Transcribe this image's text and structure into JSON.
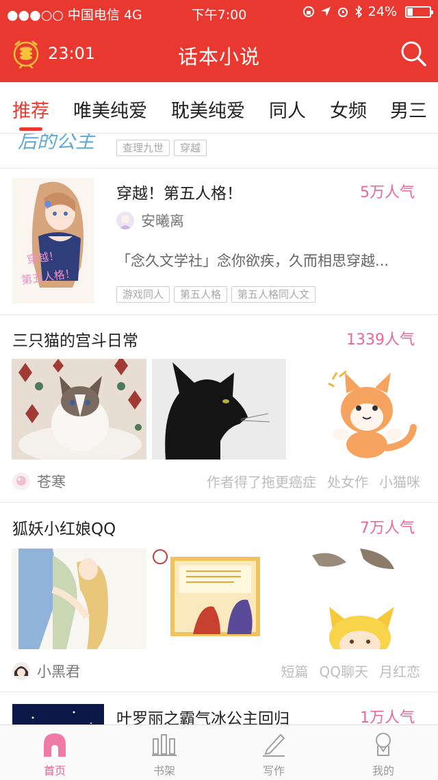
{
  "status_bar": {
    "carrier": "●●●○○ 中国电信 4G",
    "time": "下午7:00",
    "battery": "24%",
    "battery_level": 0.24
  },
  "nav": {
    "timer": "23:01",
    "title": "话本小说"
  },
  "tabs": [
    "推荐",
    "唯美纯爱",
    "耽美纯爱",
    "同人",
    "女频",
    "男三"
  ],
  "feed": {
    "partial_item": {
      "cover_text": "后的公主",
      "tags": [
        "查理九世",
        "穿越"
      ]
    },
    "book1": {
      "title": "穿越！第五人格！",
      "popularity": "5万人气",
      "author": "安曦离",
      "description": "「念久文学社」念你欲疾，久而相思穿越...",
      "tags": [
        "游戏同人",
        "第五人格",
        "第五人格同人文"
      ]
    },
    "story1": {
      "title": "三只猫的宫斗日常",
      "popularity": "1339人气",
      "author": "苍寒",
      "tags": [
        "作者得了拖更癌症",
        "处女作",
        "小猫咪"
      ]
    },
    "story2": {
      "title": "狐妖小红娘QQ",
      "popularity": "7万人气",
      "author": "小黑君",
      "tags": [
        "短篇",
        "QQ聊天",
        "月红恋"
      ]
    },
    "book2": {
      "title": "叶罗丽之霸气冰公主回归",
      "popularity": "1万人气"
    }
  },
  "tabbar": [
    {
      "label": "首页",
      "icon": "home-icon"
    },
    {
      "label": "书架",
      "icon": "bookshelf-icon"
    },
    {
      "label": "写作",
      "icon": "pen-icon"
    },
    {
      "label": "我的",
      "icon": "profile-icon"
    }
  ],
  "colors": {
    "brand_red": "#e8382f",
    "popularity_pink": "#e9679a",
    "active_tab_pink": "#ec5f8e"
  }
}
